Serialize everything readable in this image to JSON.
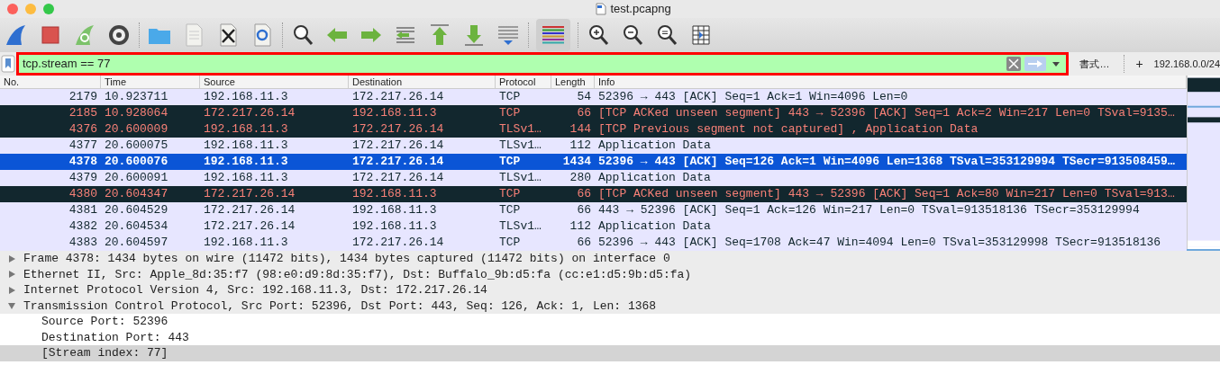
{
  "window": {
    "title": "test.pcapng"
  },
  "toolbar": {
    "coloring_on": true
  },
  "filter": {
    "value": "tcp.stream == 77",
    "valid": true,
    "buttons": [
      "書式…",
      "+",
      "192.168.0.0/24"
    ]
  },
  "packet_list": {
    "columns": [
      "No.",
      "Time",
      "Source",
      "Destination",
      "Protocol",
      "Length",
      "Info"
    ],
    "rows": [
      {
        "kind": "normal",
        "selected": false,
        "cells": [
          "2179",
          "10.923711",
          "192.168.11.3",
          "172.217.26.14",
          "TCP",
          "54",
          "52396 → 443 [ACK] Seq=1 Ack=1 Win=4096 Len=0"
        ]
      },
      {
        "kind": "error",
        "selected": false,
        "cells": [
          "2185",
          "10.928064",
          "172.217.26.14",
          "192.168.11.3",
          "TCP",
          "66",
          "[TCP ACKed unseen segment] 443 → 52396 [ACK] Seq=1 Ack=2 Win=217 Len=0 TSval=9135…"
        ]
      },
      {
        "kind": "error",
        "selected": false,
        "cells": [
          "4376",
          "20.600009",
          "192.168.11.3",
          "172.217.26.14",
          "TLSv1…",
          "144",
          "[TCP Previous segment not captured] , Application Data"
        ]
      },
      {
        "kind": "normal",
        "selected": false,
        "cells": [
          "4377",
          "20.600075",
          "192.168.11.3",
          "172.217.26.14",
          "TLSv1…",
          "112",
          "Application Data"
        ]
      },
      {
        "kind": "normal",
        "selected": true,
        "cells": [
          "4378",
          "20.600076",
          "192.168.11.3",
          "172.217.26.14",
          "TCP",
          "1434",
          "52396 → 443 [ACK] Seq=126 Ack=1 Win=4096 Len=1368 TSval=353129994 TSecr=913508459…"
        ]
      },
      {
        "kind": "normal",
        "selected": false,
        "cells": [
          "4379",
          "20.600091",
          "192.168.11.3",
          "172.217.26.14",
          "TLSv1…",
          "280",
          "Application Data"
        ]
      },
      {
        "kind": "error",
        "selected": false,
        "cells": [
          "4380",
          "20.604347",
          "172.217.26.14",
          "192.168.11.3",
          "TCP",
          "66",
          "[TCP ACKed unseen segment] 443 → 52396 [ACK] Seq=1 Ack=80 Win=217 Len=0 TSval=913…"
        ]
      },
      {
        "kind": "normal",
        "selected": false,
        "cells": [
          "4381",
          "20.604529",
          "172.217.26.14",
          "192.168.11.3",
          "TCP",
          "66",
          "443 → 52396 [ACK] Seq=1 Ack=126 Win=217 Len=0 TSval=913518136 TSecr=353129994"
        ]
      },
      {
        "kind": "normal",
        "selected": false,
        "cells": [
          "4382",
          "20.604534",
          "172.217.26.14",
          "192.168.11.3",
          "TLSv1…",
          "112",
          "Application Data"
        ]
      },
      {
        "kind": "normal",
        "selected": false,
        "cells": [
          "4383",
          "20.604597",
          "192.168.11.3",
          "172.217.26.14",
          "TCP",
          "66",
          "52396 → 443 [ACK] Seq=1708 Ack=47 Win=4094 Len=0 TSval=353129998 TSecr=913518136"
        ]
      }
    ]
  },
  "details": [
    {
      "label": "Frame 4378: 1434 bytes on wire (11472 bits), 1434 bytes captured (11472 bits) on interface 0",
      "expanded": false,
      "selected": false
    },
    {
      "label": "Ethernet II, Src: Apple_8d:35:f7 (98:e0:d9:8d:35:f7), Dst: Buffalo_9b:d5:fa (cc:e1:d5:9b:d5:fa)",
      "expanded": false,
      "selected": false
    },
    {
      "label": "Internet Protocol Version 4, Src: 192.168.11.3, Dst: 172.217.26.14",
      "expanded": false,
      "selected": false
    },
    {
      "label": "Transmission Control Protocol, Src Port: 52396, Dst Port: 443, Seq: 126, Ack: 1, Len: 1368",
      "expanded": true,
      "selected": false,
      "children": [
        {
          "label": "Source Port: 52396",
          "selected": false
        },
        {
          "label": "Destination Port: 443",
          "selected": false
        },
        {
          "label": "[Stream index: 77]",
          "selected": true
        }
      ]
    }
  ]
}
